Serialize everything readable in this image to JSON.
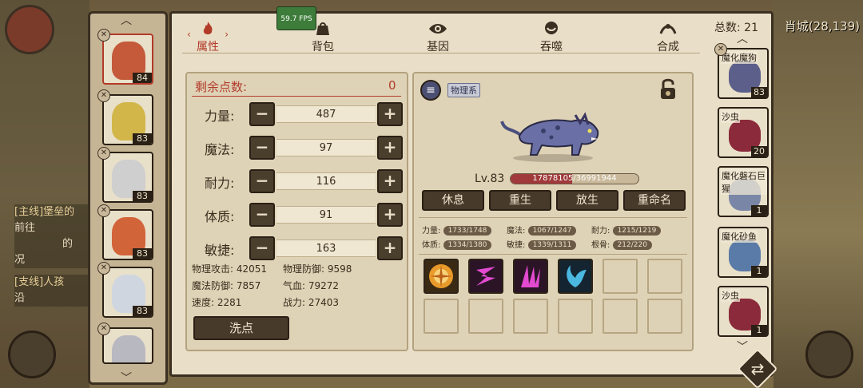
{
  "hud": {
    "fps": "59.7 FPS",
    "location": "肖城(28,139)",
    "quest1": "[主线]堡垒的",
    "quest1b": "前往",
    "quest1c": "的",
    "quest1d": "况",
    "quest2": "[支线]人孩",
    "quest2b": "沿"
  },
  "tabs": [
    {
      "label": "属性",
      "icon": "fire-icon"
    },
    {
      "label": "背包",
      "icon": "bag-icon"
    },
    {
      "label": "基因",
      "icon": "eye-icon"
    },
    {
      "label": "吞噬",
      "icon": "devour-icon"
    },
    {
      "label": "合成",
      "icon": "synthesis-icon"
    }
  ],
  "stats_panel": {
    "remaining_label": "剩余点数:",
    "remaining_value": "0",
    "stats": [
      {
        "label": "力量:",
        "value": "487"
      },
      {
        "label": "魔法:",
        "value": "97"
      },
      {
        "label": "耐力:",
        "value": "116"
      },
      {
        "label": "体质:",
        "value": "91"
      },
      {
        "label": "敏捷:",
        "value": "163"
      }
    ],
    "derived": [
      {
        "label": "物理攻击:",
        "value": "42051"
      },
      {
        "label": "物理防御:",
        "value": "9598"
      },
      {
        "label": "魔法防御:",
        "value": "7857"
      },
      {
        "label": "气血:",
        "value": "79272"
      },
      {
        "label": "速度:",
        "value": "2281"
      },
      {
        "label": "战力:",
        "value": "27403"
      }
    ],
    "reset_label": "洗点"
  },
  "pet": {
    "type_tag": "物理系",
    "level": "Lv.83",
    "hp": "17878105/36991944",
    "hp_fraction": 0.48,
    "actions": [
      "休息",
      "重生",
      "放生",
      "重命名"
    ],
    "aptitudes": [
      {
        "label": "力量:",
        "value": "1733/1748"
      },
      {
        "label": "魔法:",
        "value": "1067/1247"
      },
      {
        "label": "耐力:",
        "value": "1215/1219"
      },
      {
        "label": "体质:",
        "value": "1334/1380"
      },
      {
        "label": "敏捷:",
        "value": "1339/1311"
      },
      {
        "label": "根骨:",
        "value": "212/220"
      }
    ],
    "skills": [
      "orange-burst-skill",
      "pink-slash-skill",
      "pink-claw-skill",
      "blue-wing-skill"
    ]
  },
  "left_list": {
    "levels": [
      "84",
      "83",
      "83",
      "83",
      "83",
      ""
    ]
  },
  "right_list": {
    "total_label": "总数: 21",
    "pets": [
      {
        "name": "魔化魔狗",
        "level": "83"
      },
      {
        "name": "沙虫",
        "level": "20"
      },
      {
        "name": "魔化磐石巨猩",
        "level": "1"
      },
      {
        "name": "魔化砂鱼",
        "level": "1"
      },
      {
        "name": "沙虫",
        "level": "1"
      }
    ]
  },
  "colors": {
    "panel": "#e9dfc8",
    "frame": "#3b2f22",
    "hp_bar": "#a03a3a",
    "accent_red": "#b23b2a"
  }
}
